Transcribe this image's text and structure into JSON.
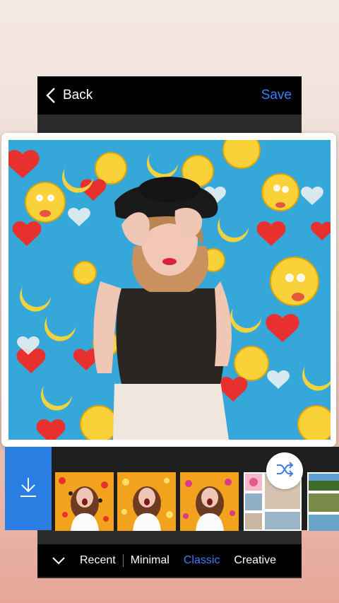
{
  "header": {
    "back_label": "Back",
    "save_label": "Save"
  },
  "tabs": [
    {
      "label": "Recent",
      "active": false
    },
    {
      "label": "Minimal",
      "active": false
    },
    {
      "label": "Classic",
      "active": true
    },
    {
      "label": "Creative",
      "active": false
    }
  ],
  "colors": {
    "accent": "#3d7df0",
    "download_bg": "#2a7de1",
    "photo_bg": "#35a7d8",
    "thumb_bg": "#f3a21e"
  },
  "icons": {
    "back": "chevron-left-icon",
    "download": "download-icon",
    "shuffle": "shuffle-icon",
    "collapse": "chevron-down-icon"
  }
}
